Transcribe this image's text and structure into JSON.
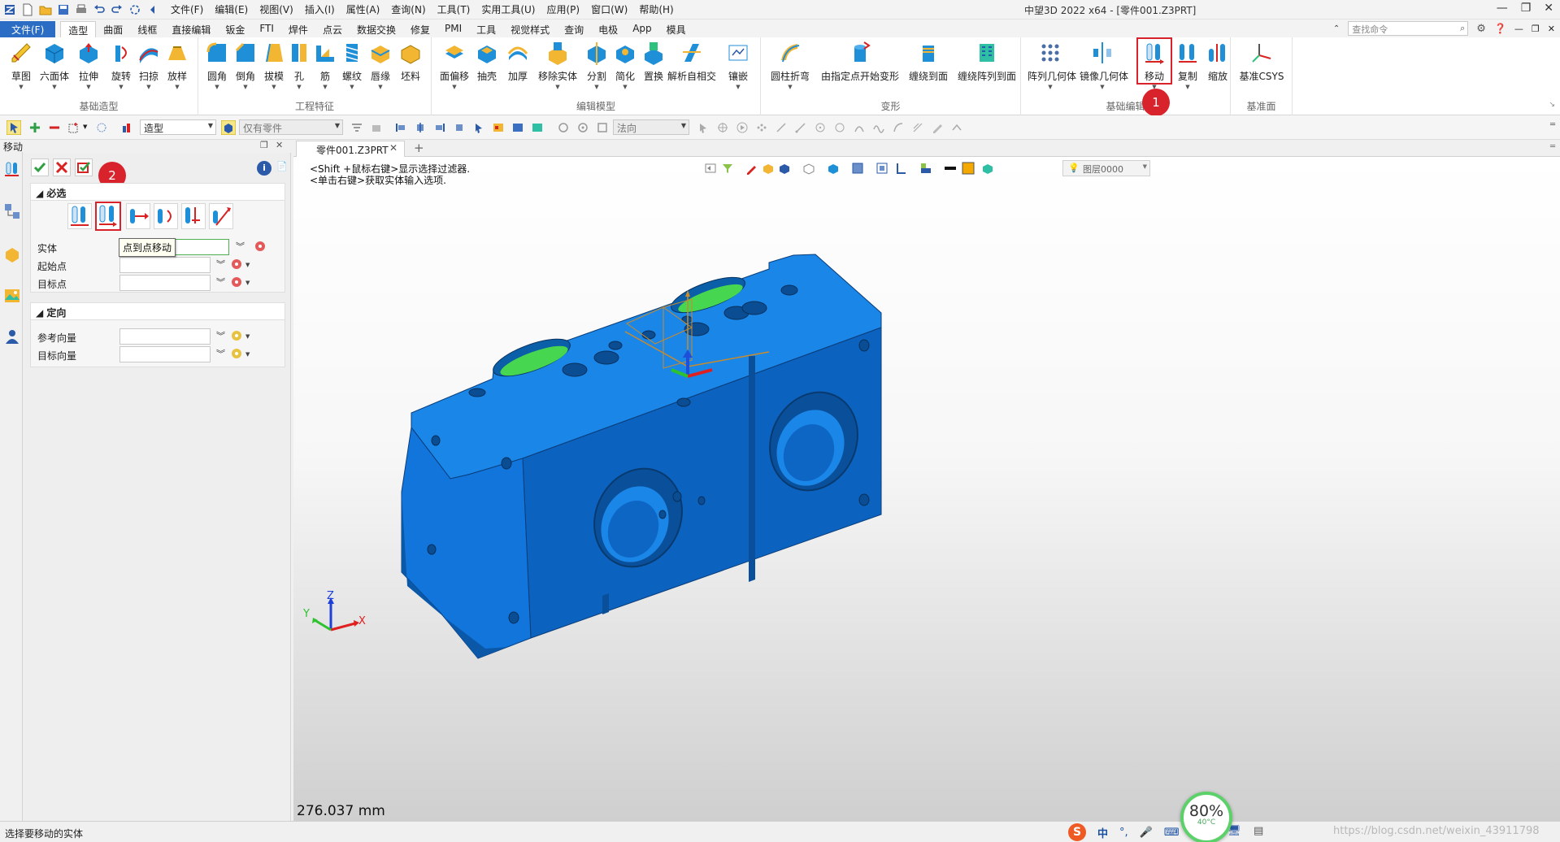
{
  "titlebar": {
    "menus": [
      "文件(F)",
      "编辑(E)",
      "视图(V)",
      "插入(I)",
      "属性(A)",
      "查询(N)",
      "工具(T)",
      "实用工具(U)",
      "应用(P)",
      "窗口(W)",
      "帮助(H)"
    ],
    "window_title": "中望3D 2022 x64 - [零件001.Z3PRT]"
  },
  "tabbar": {
    "file_tab": "文件(F)",
    "tabs": [
      "造型",
      "曲面",
      "线框",
      "直接编辑",
      "钣金",
      "FTI",
      "焊件",
      "点云",
      "数据交换",
      "修复",
      "PMI",
      "工具",
      "视觉样式",
      "查询",
      "电极",
      "App",
      "模具"
    ],
    "active_tab": "造型",
    "search_placeholder": "查找命令"
  },
  "ribbon": {
    "groups": {
      "basic_shape": {
        "name": "基础造型",
        "buttons": [
          "草图",
          "六面体",
          "拉伸",
          "旋转",
          "扫掠",
          "放样"
        ]
      },
      "engineering": {
        "name": "工程特征",
        "buttons": [
          "圆角",
          "倒角",
          "拔模",
          "孔",
          "筋",
          "螺纹",
          "唇缘",
          "坯料"
        ]
      },
      "edit_model": {
        "name": "编辑模型",
        "buttons": [
          "面偏移",
          "抽壳",
          "加厚",
          "移除实体",
          "分割",
          "简化",
          "置换",
          "解析自相交",
          "镶嵌"
        ]
      },
      "deform": {
        "name": "变形",
        "buttons": [
          "圆柱折弯",
          "由指定点开始变形",
          "缠绕到面",
          "缠绕阵列到面"
        ]
      },
      "basic_edit": {
        "name": "基础编辑",
        "buttons": [
          "阵列几何体",
          "镜像几何体",
          "移动",
          "复制",
          "缩放"
        ]
      },
      "datum": {
        "name": "基准面",
        "buttons": [
          "基准CSYS"
        ]
      }
    },
    "badge_1": "1"
  },
  "toolbar": {
    "filter_value": "造型",
    "scope_value": "仅有零件",
    "direction_value": "法向"
  },
  "panel": {
    "title": "移动",
    "badge_2": "2",
    "required_section": "必选",
    "tooltip": "点到点移动",
    "fields": {
      "entity": "实体",
      "start_point": "起始点",
      "target_point": "目标点"
    },
    "orientation_section": "定向",
    "orient_fields": {
      "ref_vector": "参考向量",
      "target_vector": "目标向量"
    }
  },
  "document": {
    "tab_label": "零件001.Z3PRT",
    "hint_line1": "<Shift +鼠标右键>显示选择过滤器.",
    "hint_line2": "<单击右键>获取实体输入选项.",
    "layer": "图层0000",
    "measurement": "276.037 mm",
    "triad_labels": {
      "x": "X",
      "y": "Y",
      "z": "Z"
    }
  },
  "statusbar": {
    "status_text": "选择要移动的实体",
    "ime_label": "中",
    "watermark": "https://blog.csdn.net/weixin_43911798"
  },
  "gauge": {
    "percent": "80%",
    "temp": "40°C"
  },
  "colors": {
    "model_blue": "#1f6fd0",
    "highlight_red": "#d9232c",
    "file_tab_blue": "#2b6cc4"
  }
}
